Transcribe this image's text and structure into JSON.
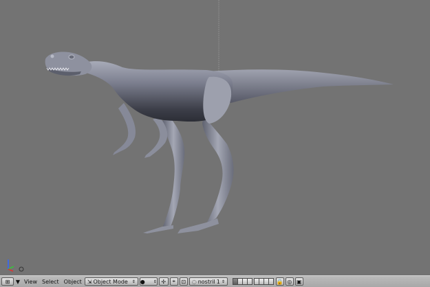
{
  "window": {
    "title": ""
  },
  "header": {
    "editor_type_icon": "3d-view-icon",
    "menus": [
      "View",
      "Select",
      "Object"
    ],
    "mode": {
      "icon": "object-mode-icon",
      "label": "Object Mode",
      "arrows": "⇕"
    },
    "shading_icon": "solid-sphere-icon",
    "pivot_icon": "pivot-icon",
    "manipulator_icon": "manipulator-icon",
    "orientation_icon": "transform-orientation-icon",
    "object_field": {
      "label": "nostril",
      "value": "1"
    },
    "layers_first_row": 8,
    "layers_second_row": 8,
    "lock_icon": "lock-icon",
    "render_icon": "render-icon"
  },
  "viewport": {
    "background": "#737373",
    "model_color": "#6f7382",
    "axis_colors": {
      "x": "#d33",
      "y": "#3c3",
      "z": "#36f"
    }
  }
}
